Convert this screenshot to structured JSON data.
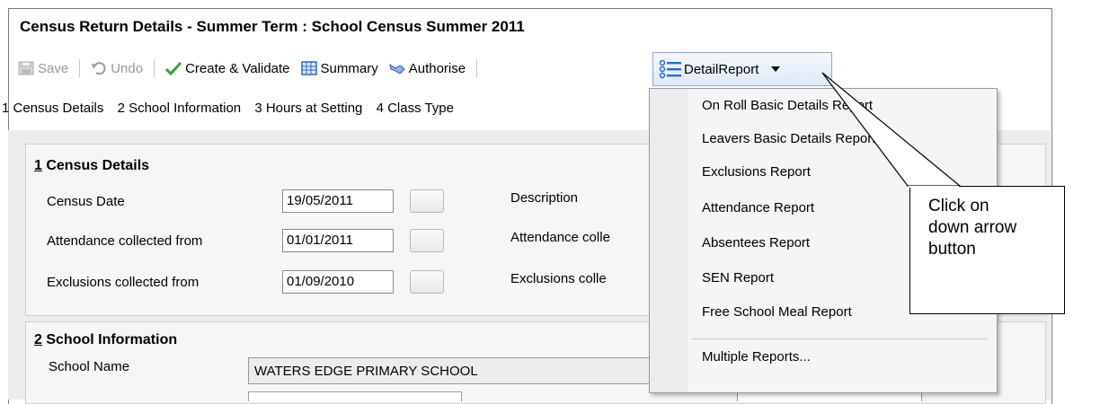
{
  "window": {
    "title": "Census Return Details - Summer Term : School Census Summer 2011"
  },
  "toolbar": {
    "save": "Save",
    "undo": "Undo",
    "create_validate": "Create & Validate",
    "summary": "Summary",
    "authorise": "Authorise",
    "detail_report": "DetailReport"
  },
  "nav": [
    "1 Census Details",
    "2 School Information",
    "3 Hours at Setting",
    "4 Class Type"
  ],
  "census_details": {
    "heading_num": "1",
    "heading_text": " Census Details",
    "rows": [
      {
        "label": "Census Date",
        "value": "19/05/2011",
        "right_label": "Description"
      },
      {
        "label": "Attendance collected from",
        "value": "01/01/2011",
        "right_label": "Attendance colle"
      },
      {
        "label": "Exclusions collected from",
        "value": "01/09/2010",
        "right_label": "Exclusions colle"
      }
    ]
  },
  "school_information": {
    "heading_num": "2",
    "heading_text": " School Information",
    "school_name_label": "School Name",
    "school_name_value": "WATERS EDGE PRIMARY SCHOOL"
  },
  "menu": {
    "items": [
      "On Roll Basic Details Report",
      "Leavers Basic Details Report",
      "Exclusions Report",
      "Attendance Report",
      "Absentees Report",
      "SEN Report",
      "Free School Meal Report",
      "Multiple Reports..."
    ]
  },
  "callout": {
    "line1": "Click on",
    "line2": "down arrow",
    "line3": "button"
  },
  "colors": {
    "accent_blue": "#2a6ad2",
    "check_green": "#3aa13a",
    "menu_bg": "#f5f5f5"
  }
}
